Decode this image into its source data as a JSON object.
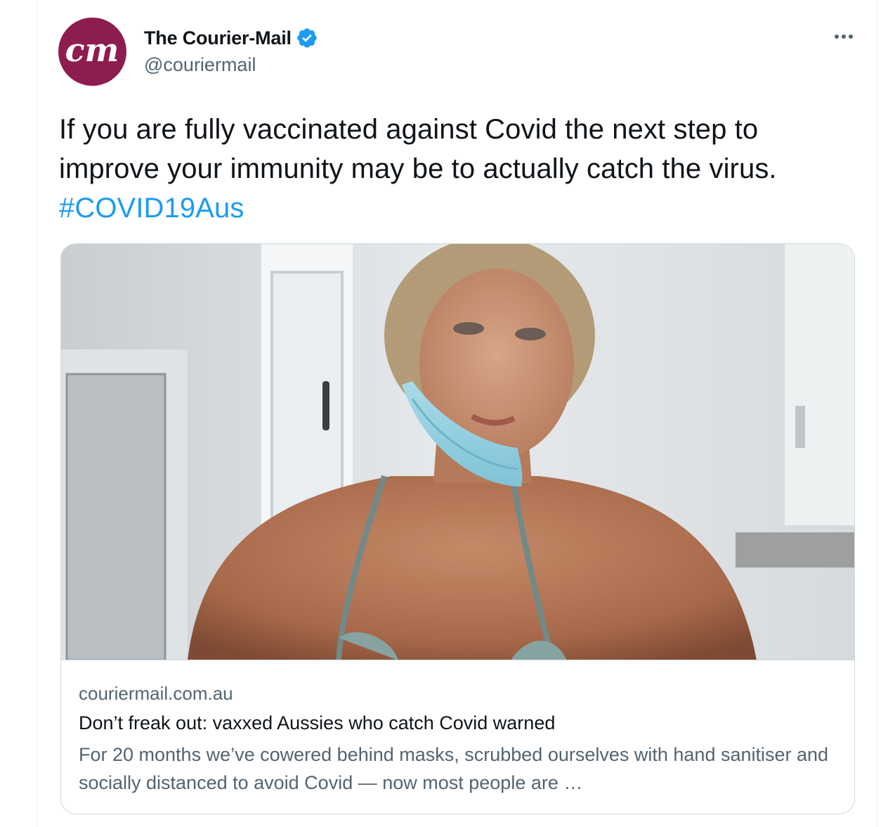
{
  "account": {
    "display_name": "The Courier-Mail",
    "handle": "@couriermail",
    "avatar_text": "cm",
    "verified": true,
    "avatar_color": "#8e1d4f"
  },
  "tweet": {
    "text": "If you are fully vaccinated against Covid the next step to improve your immunity may be to actually catch the virus.",
    "hashtag": "#COVID19Aus"
  },
  "card": {
    "domain": "couriermail.com.au",
    "title": "Don’t freak out: vaxxed Aussies who catch Covid warned",
    "description": "For 20 months we’ve cowered behind masks, scrubbed ourselves with hand sanitiser and socially distanced to avoid Covid — now most people are …"
  },
  "icons": {
    "more": "more-horizontal-icon",
    "verified": "verified-badge-icon"
  },
  "colors": {
    "link": "#1d9bf0",
    "secondary_text": "#536471",
    "verified": "#1d9bf0"
  }
}
